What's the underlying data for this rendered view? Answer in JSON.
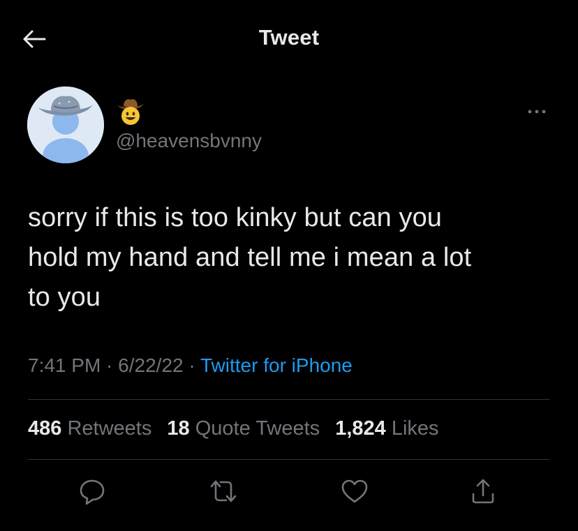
{
  "header": {
    "back_icon": "arrow-left-icon",
    "title": "Tweet"
  },
  "author": {
    "avatar_icon": "cowboy-avatar-icon",
    "display_emoji_icon": "cowboy-hat-face-emoji-icon",
    "handle": "@heavensbvnny",
    "more_icon": "more-options-icon"
  },
  "tweet": {
    "line1": "sorry if this is too kinky but can you",
    "line2": "hold my hand and tell me i mean a lot",
    "line3": "to you"
  },
  "meta": {
    "time": "7:41 PM",
    "date": "6/22/22",
    "source": "Twitter for iPhone",
    "separator": " · "
  },
  "stats": {
    "retweets_count": "486",
    "retweets_label": "Retweets",
    "quotes_count": "18",
    "quotes_label": "Quote Tweets",
    "likes_count": "1,824",
    "likes_label": "Likes"
  },
  "actions": {
    "reply_icon": "reply-icon",
    "retweet_icon": "retweet-icon",
    "like_icon": "heart-icon",
    "share_icon": "share-icon"
  },
  "colors": {
    "background": "#000000",
    "text": "#e7e9ea",
    "secondary": "#71767b",
    "link": "#1d9bf0",
    "divider": "#2f3336"
  }
}
